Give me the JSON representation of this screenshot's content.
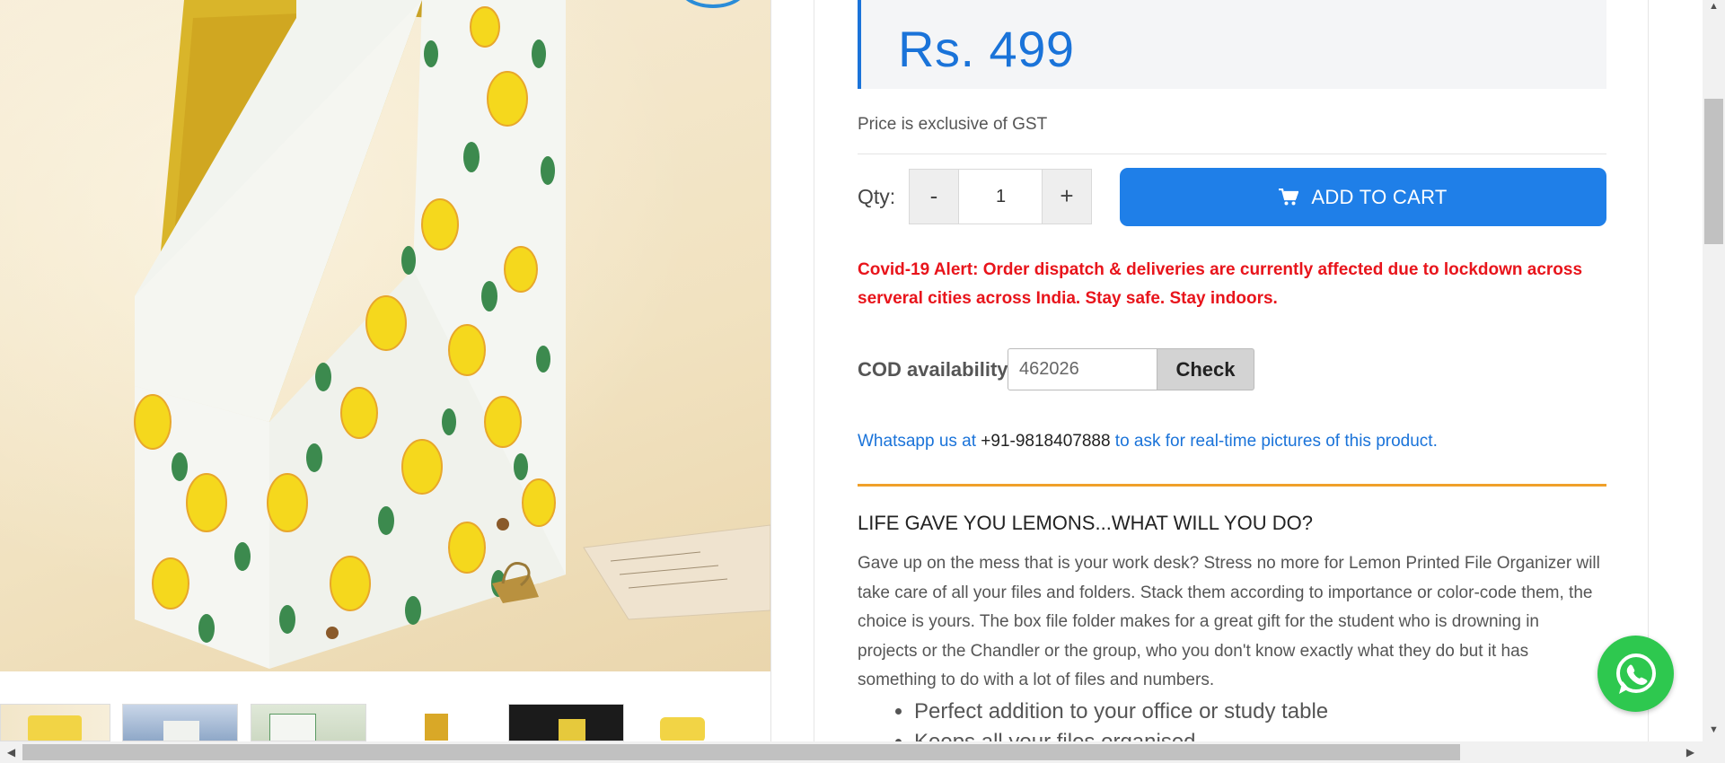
{
  "product": {
    "price": "Rs. 499",
    "gst_note": "Price is exclusive of GST"
  },
  "quantity": {
    "label": "Qty:",
    "minus": "-",
    "value": "1",
    "plus": "+"
  },
  "cart": {
    "icon": "cart-icon",
    "label": "ADD TO CART"
  },
  "alert": {
    "text": "Covid-19 Alert: Order dispatch & deliveries are currently affected due to lockdown across serveral cities across India. Stay safe. Stay indoors."
  },
  "cod": {
    "label": "COD availability",
    "pincode": "462026",
    "check_label": "Check"
  },
  "whatsapp": {
    "prefix": "Whatsapp us at ",
    "number": "+91-9818407888",
    "suffix": " to ask for real-time pictures of this product."
  },
  "description": {
    "heading": "LIFE GAVE YOU LEMONS...WHAT WILL YOU DO?",
    "body": "Gave up on the mess that is your work desk? Stress no more for Lemon Printed File Organizer will take care of all your files and folders. Stack them according to importance or color-code them, the choice is yours. The box file folder makes for a great gift for the student who is drowning in projects or the Chandler or the group, who you don't know exactly what they do but it has something to do with a lot of files and numbers.",
    "bullets": [
      "Perfect addition to your office or study table",
      "Keeps all your files organised"
    ]
  },
  "colors": {
    "accent": "#1a73d9",
    "cart_button": "#1f7fe8",
    "alert": "#e8141b",
    "rule": "#f0a02a",
    "whatsapp": "#2ec84f"
  }
}
